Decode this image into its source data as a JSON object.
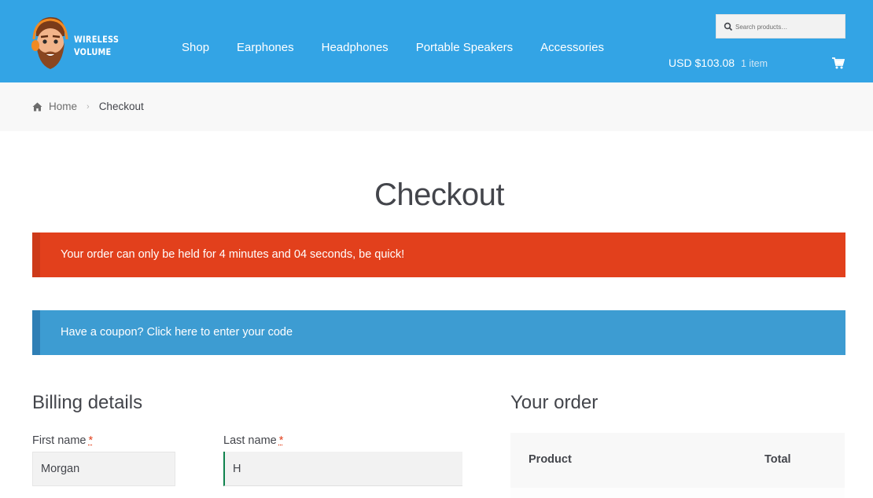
{
  "header": {
    "logo_text_line1": "WIRELESS",
    "logo_text_line2": "VOLUME",
    "nav": [
      "Shop",
      "Earphones",
      "Headphones",
      "Portable Speakers",
      "Accessories"
    ],
    "search_placeholder": "Search products…",
    "cart_amount": "USD $103.08",
    "cart_count": "1 item",
    "background_color": "#33a4e5"
  },
  "breadcrumb": {
    "home": "Home",
    "current": "Checkout"
  },
  "page_title": "Checkout",
  "notices": {
    "error_text": "Your order can only be held for 4 minutes and 04 seconds, be quick!",
    "error_color": "#e2401c",
    "coupon_text": "Have a coupon? Click here to enter your code",
    "info_color": "#3d9cd2"
  },
  "billing": {
    "title": "Billing details",
    "first_name_label": "First name",
    "first_name_value": "Morgan",
    "last_name_label": "Last name",
    "last_name_value": "H",
    "required_mark": "*"
  },
  "order": {
    "title": "Your order",
    "col_product": "Product",
    "col_total": "Total"
  }
}
